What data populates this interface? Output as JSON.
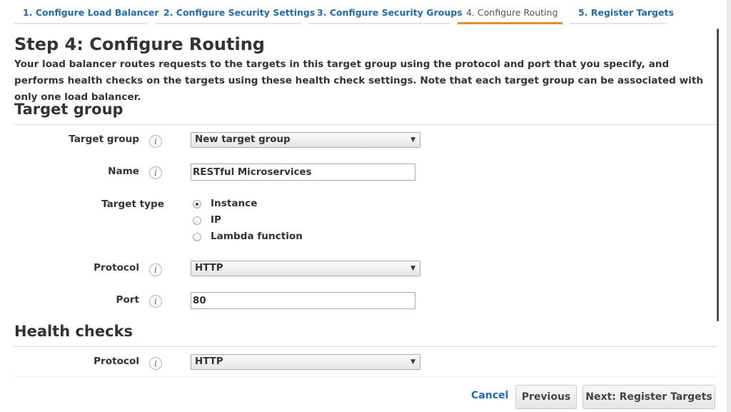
{
  "wizard": {
    "steps": [
      {
        "label": "1. Configure Load Balancer"
      },
      {
        "label": "2. Configure Security Settings"
      },
      {
        "label": "3. Configure Security Groups"
      },
      {
        "label": "4. Configure Routing"
      },
      {
        "label": "5. Register Targets"
      }
    ],
    "active_step": 4
  },
  "page": {
    "title": "Step 4: Configure Routing",
    "description": "Your load balancer routes requests to the targets in this target group using the protocol and port that you specify, and performs health checks on the targets using these health check settings. Note that each target group can be associated with only one load balancer."
  },
  "target_group_section": {
    "heading": "Target group",
    "target_group": {
      "label": "Target group",
      "value": "New target group"
    },
    "name": {
      "label": "Name",
      "value": "RESTful Microservices"
    },
    "target_type": {
      "label": "Target type",
      "options": [
        {
          "label": "Instance",
          "checked": true
        },
        {
          "label": "IP",
          "checked": false
        },
        {
          "label": "Lambda function",
          "checked": false
        }
      ]
    },
    "protocol": {
      "label": "Protocol",
      "value": "HTTP"
    },
    "port": {
      "label": "Port",
      "value": "80"
    }
  },
  "health_checks_section": {
    "heading": "Health checks",
    "protocol": {
      "label": "Protocol",
      "value": "HTTP"
    }
  },
  "info_icon_glyph": "i",
  "dropdown_arrow_glyph": "▼",
  "footer": {
    "cancel_label": "Cancel",
    "previous_label": "Previous",
    "next_label": "Next: Register Targets"
  },
  "colors": {
    "link_blue": "#1f6bb5",
    "active_tab_underline": "#e88e21"
  }
}
